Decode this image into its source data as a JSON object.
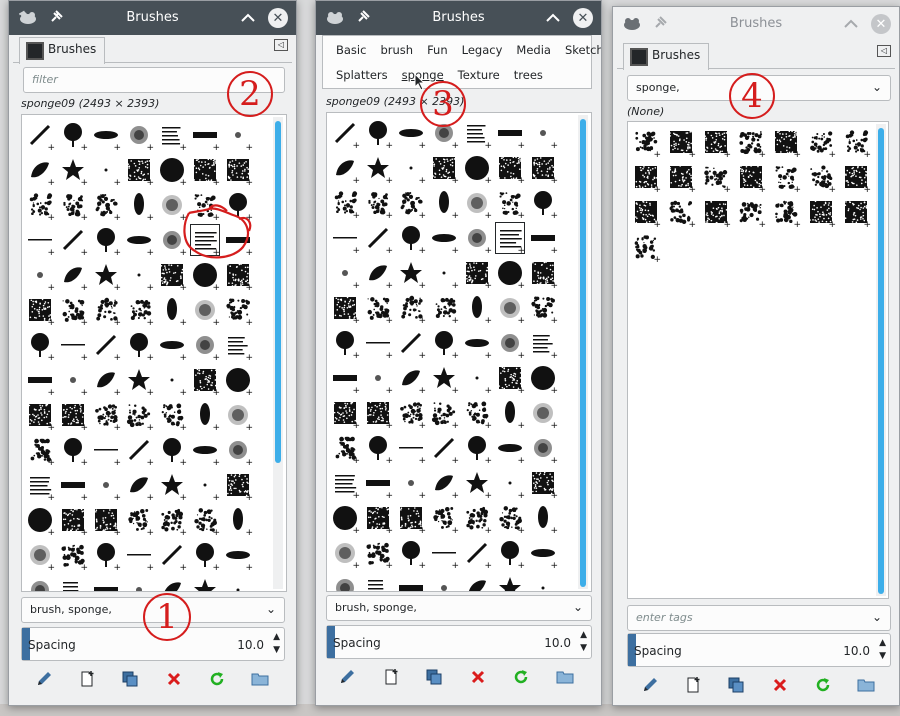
{
  "windows": [
    {
      "title": "Brushes",
      "tab_label": "Brushes",
      "filter_placeholder": "filter",
      "brush_info": "sponge09 (2493 × 2393)",
      "tags_value": "brush, sponge,",
      "spacing_label": "Spacing",
      "spacing_value": "10.0",
      "annotation": "1",
      "annotation2": "2"
    },
    {
      "title": "Brushes",
      "brush_info": "sponge09 (2493 × 2393)",
      "tags_value": "brush, sponge,",
      "spacing_label": "Spacing",
      "spacing_value": "10.0",
      "annotation": "3",
      "tag_menu_row1": [
        "Basic",
        "brush",
        "Fun",
        "Legacy",
        "Media",
        "Sketch"
      ],
      "tag_menu_row2": [
        "Splatters",
        "sponge",
        "Texture",
        "trees"
      ]
    },
    {
      "title": "Brushes",
      "tab_label": "Brushes",
      "filter_value": "sponge,",
      "brush_info": "(None)",
      "tags_placeholder": "enter tags",
      "spacing_label": "Spacing",
      "spacing_value": "10.0",
      "annotation": "4"
    }
  ],
  "icons": {
    "app": "gimp-wilber-icon",
    "pin": "pin-icon",
    "minimize": "chevron-up-icon",
    "close": "close-icon",
    "tab_menu": "tab-menu-icon",
    "edit": "pencil-icon",
    "new": "new-brush-icon",
    "duplicate": "duplicate-icon",
    "delete": "delete-icon",
    "refresh": "refresh-icon",
    "open": "folder-icon"
  },
  "colors": {
    "titlebar": "#475057",
    "accent": "#3daee9",
    "annotation": "#d51d1d",
    "delete": "#da1c1c",
    "refresh": "#22b022"
  }
}
